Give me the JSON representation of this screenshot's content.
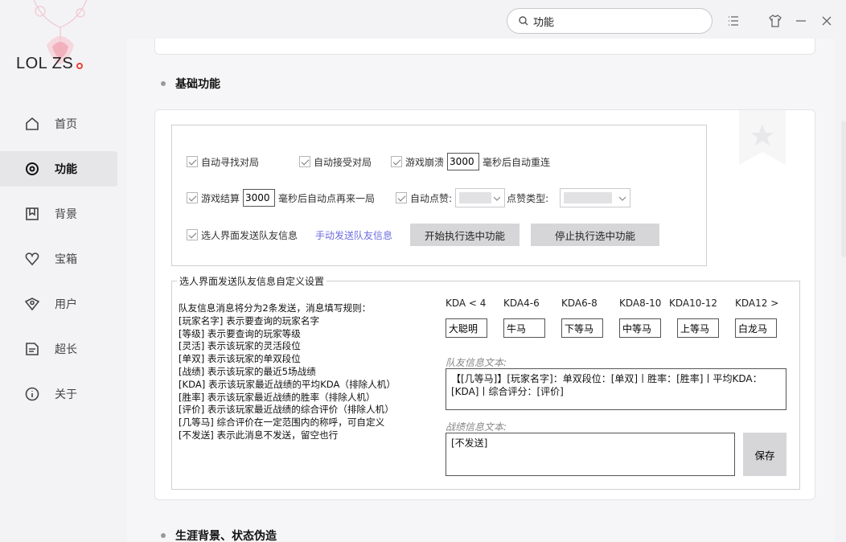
{
  "app": {
    "logo": "LOL ZS"
  },
  "search": {
    "value": "功能"
  },
  "nav": [
    {
      "label": "首页",
      "icon": "home-icon",
      "active": false
    },
    {
      "label": "功能",
      "icon": "target-icon",
      "active": true
    },
    {
      "label": "背景",
      "icon": "bookmark-icon",
      "active": false
    },
    {
      "label": "宝箱",
      "icon": "heart-icon",
      "active": false
    },
    {
      "label": "用户",
      "icon": "shield-icon",
      "active": false
    },
    {
      "label": "超长",
      "icon": "document-icon",
      "active": false
    },
    {
      "label": "关于",
      "icon": "info-icon",
      "active": false
    }
  ],
  "section1": {
    "title": "基础功能"
  },
  "section2": {
    "title": "生涯背景、状态伪造"
  },
  "options": {
    "auto_find": "自动寻找对局",
    "auto_accept": "自动接受对局",
    "crash_prefix": "游戏崩溃",
    "crash_ms": "3000",
    "crash_suffix": "毫秒后自动重连",
    "end_prefix": "游戏结算",
    "end_ms": "3000",
    "end_suffix": "毫秒后自动点再来一局",
    "auto_like": "自动点赞:",
    "like_type": "点赞类型:",
    "send_info": "选人界面发送队友信息",
    "manual_send": "手动发送队友信息",
    "start_btn": "开始执行选中功能",
    "stop_btn": "停止执行选中功能"
  },
  "custom": {
    "legend": "选人界面发送队友信息自定义设置",
    "rules": [
      "队友信息消息将分为2条发送，消息填写规则：",
      "[玩家名字] 表示要查询的玩家名字",
      "[等级] 表示要查询的玩家等级",
      "[灵活] 表示该玩家的灵活段位",
      "[单双] 表示该玩家的单双段位",
      "[战绩] 表示该玩家的最近5场战绩",
      "[KDA]  表示该玩家最近战绩的平均KDA（排除人机）",
      "[胜率] 表示该玩家最近战绩的胜率（排除人机）",
      "[评价] 表示该玩家最近战绩的综合评价（排除人机）",
      "[几等马] 综合评价在一定范围内的称呼，可自定义",
      "[不发送] 表示此消息不发送，留空也行"
    ],
    "kda_headers": [
      "KDA < 4",
      "KDA4-6",
      "KDA6-8",
      "KDA8-10",
      "KDA10-12",
      "KDA12 >"
    ],
    "kda_values": [
      "大聪明",
      "牛马",
      "下等马",
      "中等马",
      "上等马",
      "白龙马"
    ],
    "team_label": "队友信息文本:",
    "team_text": "【[几等马]】[玩家名字]：单双段位：[单双]丨胜率：[胜率]丨平均KDA：[KDA]丨综合评分：[评价]",
    "record_label": "战绩信息文本:",
    "record_text": "[不发送]",
    "save_btn": "保存"
  }
}
